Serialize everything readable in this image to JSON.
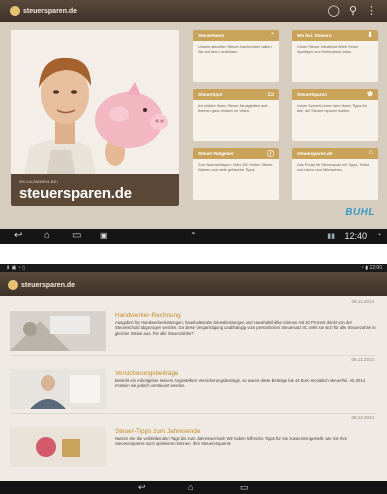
{
  "tablet": {
    "app_name": "steuersparen.de",
    "hero": {
      "small": "WILLKOMMEN BEI",
      "big": "steuersparen.de"
    },
    "tiles": [
      {
        "title": "SteuerNews",
        "text": "Unsere aktuellen Steuer-Nachrichten halten Sie auf dem Laufenden.",
        "icon": "wifi-icon",
        "glyph": "◔"
      },
      {
        "title": "Wo bei. Steuern",
        "text": "Unser Steuer-Infodienst liefert Ihnen Spartipps und Hintergrund-Infos.",
        "icon": "download-icon",
        "glyph": "⬇"
      },
      {
        "title": "SteuerSpot",
        "text": "Ich erkläre Ihnen Steuer-Neuigkeiten und -themen ganz einfach im Video.",
        "icon": "tv-icon",
        "glyph": "▭"
      },
      {
        "title": "SteuerSparen",
        "text": "Unser Schnell-Lesen dem Ihnen Tipps für alle, die Steuern sparen wollen.",
        "icon": "piggy-icon",
        "glyph": "❀"
      },
      {
        "title": "Steuer-Ratgeber",
        "text": "Zum Nachschlagen: Über 400 Seiten Steuer-Wissen und viele geldwerte Tipps.",
        "icon": "info-icon",
        "glyph": "ⓘ"
      },
      {
        "title": "steuersparen.de",
        "text": "Das Portal für Steuerspart mit Tipps, Tricks und Ideen zum Mitmachen.",
        "icon": "home-icon",
        "glyph": "⌂"
      }
    ],
    "brand_badge": "BUHL",
    "clock": "12:40"
  },
  "phone": {
    "app_name": "steuersparen.de",
    "status_time": "12:00",
    "articles": [
      {
        "date": "09.12.2013",
        "title": "Handwerker-Rechnung",
        "text": "Ausgaben für Handwerkerleistungen, haushaltsnahe Dienstleistungen und Haushaltshilfen können mit 20 Prozent direkt von der Steuerschuld abgezogen werden. Da diese Vergünstigung unabhängig vom persönlichen Steuersatz ist, wirkt sie sich für alle Steuerzahler in gleicher Weise aus. Für alle Steuerzahler?"
      },
      {
        "date": "09.12.2013",
        "title": "Versicherungsbeiträge",
        "text": "Besteht ein Arbeitgeber seinem Angestellten Versicherungsbeiträge, so waren diese Beiträge bis 44 Euro monatlich steuerfrei. Ab 2014 müssen sie jedoch versteuert werden."
      },
      {
        "date": "09.12.2013",
        "title": "Steuer-Tipps zum Jahresende",
        "text": "Nutzen Sie die verbleibenden Tage bis zum Jahreswechsel! Wir haben hilfreiche Tipps für Sie zusammengestellt, wie Sie Ihre Steuerersparnis noch optimieren können. Ihre Steuerersparnis"
      }
    ]
  }
}
